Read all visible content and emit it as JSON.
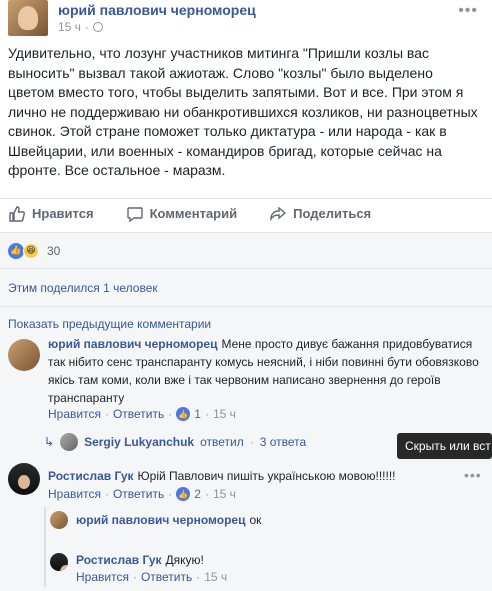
{
  "post": {
    "author": "юрий павлович черноморец",
    "time": "15 ч",
    "text": "Удивительно, что лозунг участников митинга \"Пришли козлы вас выносить\" вызвал такой ажиотаж. Слово \"козлы\" было выделено цветом вместо того, чтобы выделить запятыми. Вот и все. При этом я лично не поддерживаю ни обанкротившихся козликов, ни разноцветных свинок. Этой стране поможет только диктатура - или народа - как в Швейцарии, или военных - командиров бригад, которые сейчас на фронте. Все остальное - маразм."
  },
  "actions": {
    "like": "Нравится",
    "comment": "Комментарий",
    "share": "Поделиться"
  },
  "reactions": {
    "count": "30"
  },
  "shares": {
    "text": "Этим поделился 1 человек"
  },
  "comments": {
    "show_previous": "Показать предыдущие комментарии",
    "items": [
      {
        "author": "юрий павлович черноморец",
        "text": "Мене просто дивує бажання придовбуватися так нібито сенс транспаранту комусь неясний, і ніби повинні бути обовязково якісь там коми, коли вже і так червоним написано звернення до героїв транспаранту",
        "like": "Нравится",
        "reply": "Ответить",
        "likes": "1",
        "time": "15 ч",
        "replies": {
          "name": "Sergiy Lukyanchuk",
          "verb": "ответил",
          "count": "3 ответа"
        }
      },
      {
        "author": "Ростислав Гук",
        "text": "Юрій Павлович пишіть українською мовою!!!!!!",
        "like": "Нравится",
        "reply": "Ответить",
        "likes": "2",
        "time": "15 ч",
        "replies_list": [
          {
            "author": "юрий павлович черноморец",
            "text": "ок"
          },
          {
            "author": "Ростислав Гук",
            "text": "Дякую!",
            "like": "Нравится",
            "reply": "Ответить",
            "time": "15 ч"
          }
        ]
      }
    ]
  },
  "tooltip": {
    "text": "Скрыть или вст"
  },
  "colors": {
    "link": "#385898",
    "meta": "#90949c",
    "background_gray": "#f5f6f7",
    "like_blue": "#4a76e8"
  }
}
